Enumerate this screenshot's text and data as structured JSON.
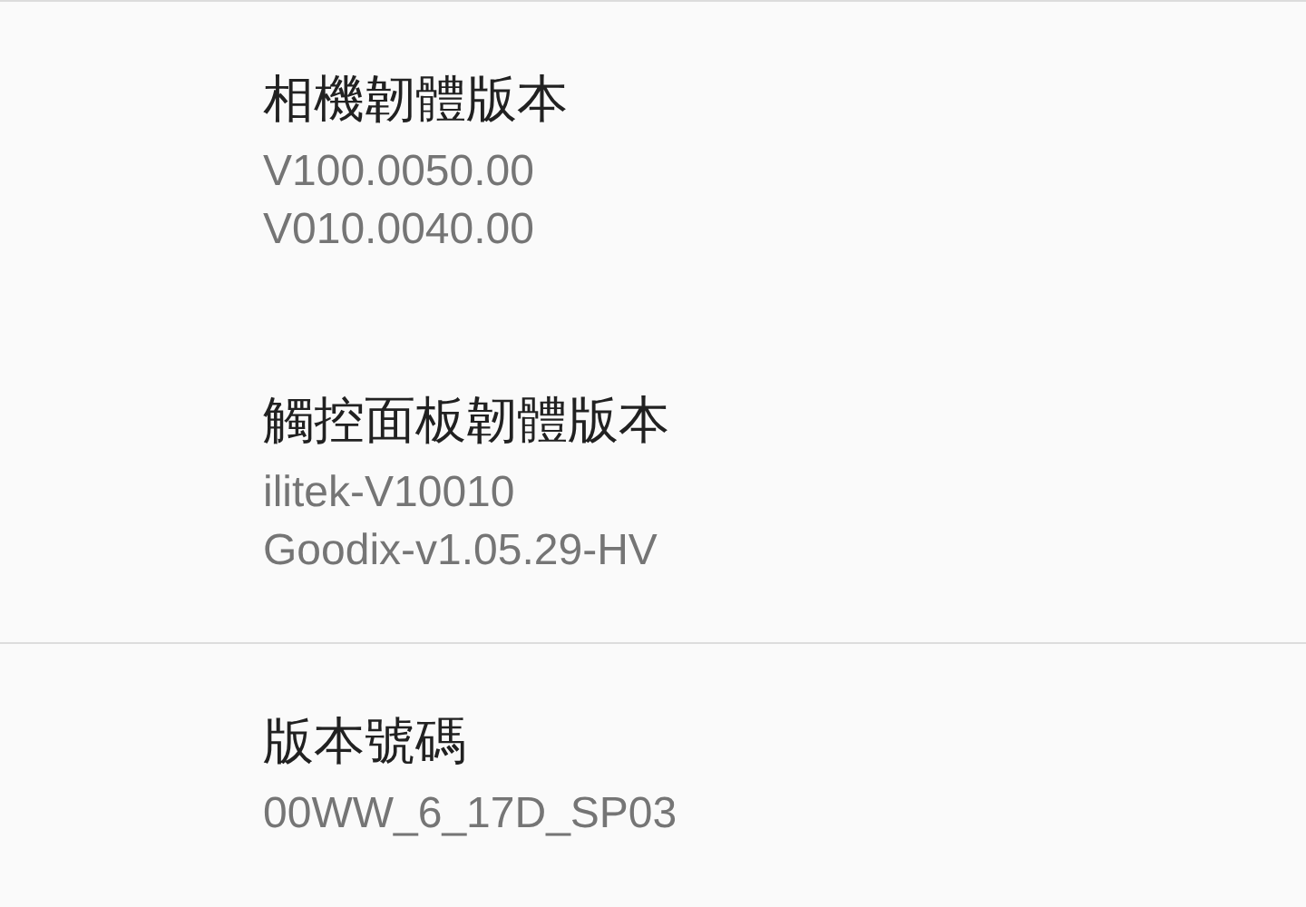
{
  "groups": [
    {
      "items": [
        {
          "title": "相機韌體版本",
          "values": [
            "V100.0050.00",
            "V010.0040.00"
          ]
        },
        {
          "title": "觸控面板韌體版本",
          "values": [
            "ilitek-V10010",
            "Goodix-v1.05.29-HV"
          ]
        }
      ]
    },
    {
      "items": [
        {
          "title": "版本號碼",
          "values": [
            "00WW_6_17D_SP03"
          ]
        }
      ]
    }
  ]
}
